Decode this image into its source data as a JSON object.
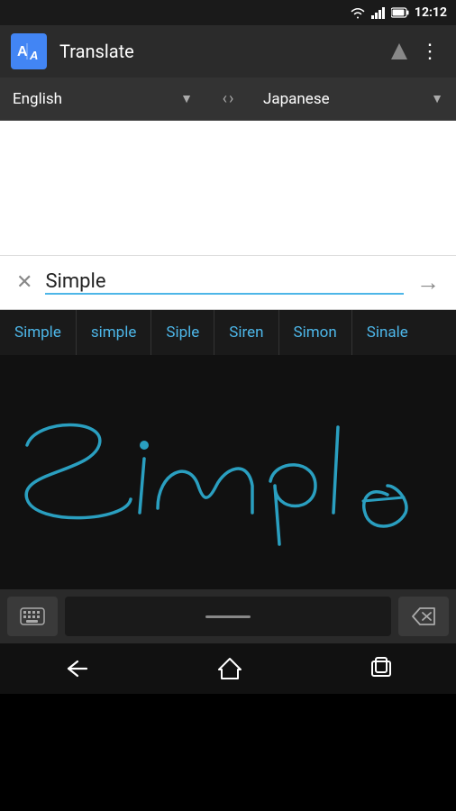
{
  "statusBar": {
    "time": "12:12",
    "icons": [
      "wifi",
      "signal",
      "battery"
    ]
  },
  "header": {
    "title": "Translate",
    "logoText": "A",
    "overflowIcon": "⋮"
  },
  "langBar": {
    "sourceLang": "English",
    "targetLang": "Japanese",
    "swapLeft": "‹",
    "swapRight": "›",
    "sourceArrow": "▼",
    "targetArrow": "▼"
  },
  "inputRow": {
    "clearIcon": "✕",
    "inputText": "Simple",
    "translateIcon": "→"
  },
  "suggestions": [
    "Simple",
    "simple",
    "Siple",
    "Siren",
    "Simon",
    "Sinale"
  ],
  "keyboardBar": {
    "keyboardIcon": "⌨",
    "backspaceIcon": "⌫"
  },
  "navBar": {
    "backLabel": "back",
    "homeLabel": "home",
    "recentLabel": "recent"
  }
}
